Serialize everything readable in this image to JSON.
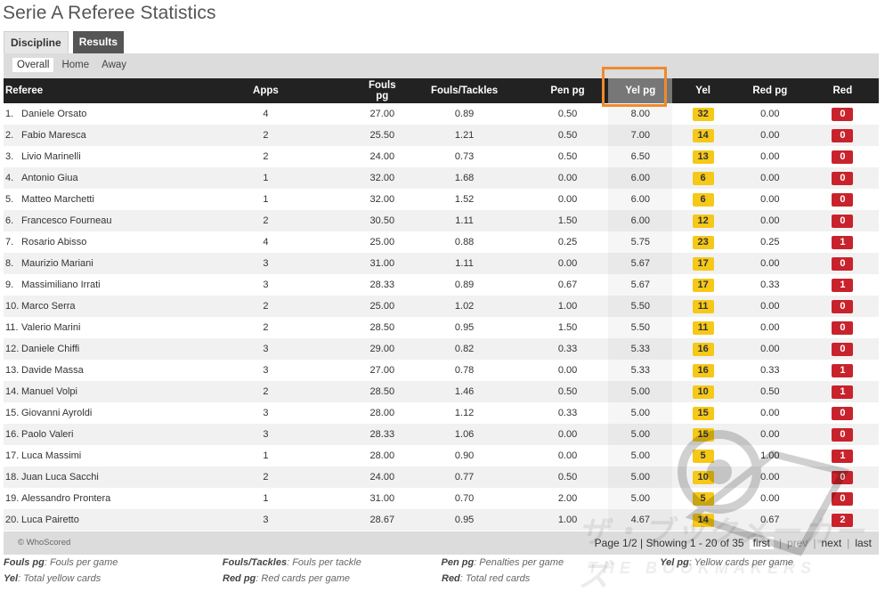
{
  "page": {
    "title": "Serie A Referee Statistics"
  },
  "tabs": [
    {
      "label": "Discipline",
      "active": true
    },
    {
      "label": "Results",
      "active": false
    }
  ],
  "subtabs": [
    {
      "label": "Overall",
      "active": true
    },
    {
      "label": "Home",
      "active": false
    },
    {
      "label": "Away",
      "active": false
    }
  ],
  "table": {
    "headers": [
      "Referee",
      "Apps",
      "Fouls pg",
      "Fouls/Tackles",
      "Pen pg",
      "Yel pg",
      "Yel",
      "Red pg",
      "Red"
    ],
    "sorted_column": "Yel pg",
    "rows": [
      {
        "rank": "1.",
        "name": "Daniele Orsato",
        "apps": "4",
        "fouls_pg": "27.00",
        "fouls_tackles": "0.89",
        "pen_pg": "0.50",
        "yel_pg": "8.00",
        "yel": "32",
        "red_pg": "0.00",
        "red": "0"
      },
      {
        "rank": "2.",
        "name": "Fabio Maresca",
        "apps": "2",
        "fouls_pg": "25.50",
        "fouls_tackles": "1.21",
        "pen_pg": "0.50",
        "yel_pg": "7.00",
        "yel": "14",
        "red_pg": "0.00",
        "red": "0"
      },
      {
        "rank": "3.",
        "name": "Livio Marinelli",
        "apps": "2",
        "fouls_pg": "24.00",
        "fouls_tackles": "0.73",
        "pen_pg": "0.50",
        "yel_pg": "6.50",
        "yel": "13",
        "red_pg": "0.00",
        "red": "0"
      },
      {
        "rank": "4.",
        "name": "Antonio Giua",
        "apps": "1",
        "fouls_pg": "32.00",
        "fouls_tackles": "1.68",
        "pen_pg": "0.00",
        "yel_pg": "6.00",
        "yel": "6",
        "red_pg": "0.00",
        "red": "0"
      },
      {
        "rank": "5.",
        "name": "Matteo Marchetti",
        "apps": "1",
        "fouls_pg": "32.00",
        "fouls_tackles": "1.52",
        "pen_pg": "0.00",
        "yel_pg": "6.00",
        "yel": "6",
        "red_pg": "0.00",
        "red": "0"
      },
      {
        "rank": "6.",
        "name": "Francesco Fourneau",
        "apps": "2",
        "fouls_pg": "30.50",
        "fouls_tackles": "1.11",
        "pen_pg": "1.50",
        "yel_pg": "6.00",
        "yel": "12",
        "red_pg": "0.00",
        "red": "0"
      },
      {
        "rank": "7.",
        "name": "Rosario Abisso",
        "apps": "4",
        "fouls_pg": "25.00",
        "fouls_tackles": "0.88",
        "pen_pg": "0.25",
        "yel_pg": "5.75",
        "yel": "23",
        "red_pg": "0.25",
        "red": "1"
      },
      {
        "rank": "8.",
        "name": "Maurizio Mariani",
        "apps": "3",
        "fouls_pg": "31.00",
        "fouls_tackles": "1.11",
        "pen_pg": "0.00",
        "yel_pg": "5.67",
        "yel": "17",
        "red_pg": "0.00",
        "red": "0"
      },
      {
        "rank": "9.",
        "name": "Massimiliano Irrati",
        "apps": "3",
        "fouls_pg": "28.33",
        "fouls_tackles": "0.89",
        "pen_pg": "0.67",
        "yel_pg": "5.67",
        "yel": "17",
        "red_pg": "0.33",
        "red": "1"
      },
      {
        "rank": "10.",
        "name": "Marco Serra",
        "apps": "2",
        "fouls_pg": "25.00",
        "fouls_tackles": "1.02",
        "pen_pg": "1.00",
        "yel_pg": "5.50",
        "yel": "11",
        "red_pg": "0.00",
        "red": "0"
      },
      {
        "rank": "11.",
        "name": "Valerio Marini",
        "apps": "2",
        "fouls_pg": "28.50",
        "fouls_tackles": "0.95",
        "pen_pg": "1.50",
        "yel_pg": "5.50",
        "yel": "11",
        "red_pg": "0.00",
        "red": "0"
      },
      {
        "rank": "12.",
        "name": "Daniele Chiffi",
        "apps": "3",
        "fouls_pg": "29.00",
        "fouls_tackles": "0.82",
        "pen_pg": "0.33",
        "yel_pg": "5.33",
        "yel": "16",
        "red_pg": "0.00",
        "red": "0"
      },
      {
        "rank": "13.",
        "name": "Davide Massa",
        "apps": "3",
        "fouls_pg": "27.00",
        "fouls_tackles": "0.78",
        "pen_pg": "0.00",
        "yel_pg": "5.33",
        "yel": "16",
        "red_pg": "0.33",
        "red": "1"
      },
      {
        "rank": "14.",
        "name": "Manuel Volpi",
        "apps": "2",
        "fouls_pg": "28.50",
        "fouls_tackles": "1.46",
        "pen_pg": "0.50",
        "yel_pg": "5.00",
        "yel": "10",
        "red_pg": "0.50",
        "red": "1"
      },
      {
        "rank": "15.",
        "name": "Giovanni Ayroldi",
        "apps": "3",
        "fouls_pg": "28.00",
        "fouls_tackles": "1.12",
        "pen_pg": "0.33",
        "yel_pg": "5.00",
        "yel": "15",
        "red_pg": "0.00",
        "red": "0"
      },
      {
        "rank": "16.",
        "name": "Paolo Valeri",
        "apps": "3",
        "fouls_pg": "28.33",
        "fouls_tackles": "1.06",
        "pen_pg": "0.00",
        "yel_pg": "5.00",
        "yel": "15",
        "red_pg": "0.00",
        "red": "0"
      },
      {
        "rank": "17.",
        "name": "Luca Massimi",
        "apps": "1",
        "fouls_pg": "28.00",
        "fouls_tackles": "0.90",
        "pen_pg": "0.00",
        "yel_pg": "5.00",
        "yel": "5",
        "red_pg": "1.00",
        "red": "1"
      },
      {
        "rank": "18.",
        "name": "Juan Luca Sacchi",
        "apps": "2",
        "fouls_pg": "24.00",
        "fouls_tackles": "0.77",
        "pen_pg": "0.50",
        "yel_pg": "5.00",
        "yel": "10",
        "red_pg": "0.00",
        "red": "0"
      },
      {
        "rank": "19.",
        "name": "Alessandro Prontera",
        "apps": "1",
        "fouls_pg": "31.00",
        "fouls_tackles": "0.70",
        "pen_pg": "2.00",
        "yel_pg": "5.00",
        "yel": "5",
        "red_pg": "0.00",
        "red": "0"
      },
      {
        "rank": "20.",
        "name": "Luca Pairetto",
        "apps": "3",
        "fouls_pg": "28.67",
        "fouls_tackles": "0.95",
        "pen_pg": "1.00",
        "yel_pg": "4.67",
        "yel": "14",
        "red_pg": "0.67",
        "red": "2"
      }
    ]
  },
  "footer": {
    "copyright": "© WhoScored",
    "page_info": "Page 1/2 | Showing 1 - 20 of 35",
    "first": "first",
    "prev": "prev",
    "next": "next",
    "last": "last"
  },
  "legend": [
    {
      "term": "Fouls pg",
      "desc": ": Fouls per game"
    },
    {
      "term": "Fouls/Tackles",
      "desc": ": Fouls per tackle"
    },
    {
      "term": "Pen pg",
      "desc": ": Penalties per game"
    },
    {
      "term": "Yel pg",
      "desc": ": Yellow cards per game"
    },
    {
      "term": "Yel",
      "desc": ": Total yellow cards"
    },
    {
      "term": "Red pg",
      "desc": ": Red cards per game"
    },
    {
      "term": "Red",
      "desc": ": Total red cards"
    }
  ],
  "watermark": {
    "title": "ザ・ブックメーカーズ",
    "subtitle": "THE BOOKMAKERS"
  },
  "colors": {
    "yellow_badge": "#f6c817",
    "red_badge": "#c8232c",
    "highlight": "#f08a2c",
    "header_bg": "#222222"
  }
}
